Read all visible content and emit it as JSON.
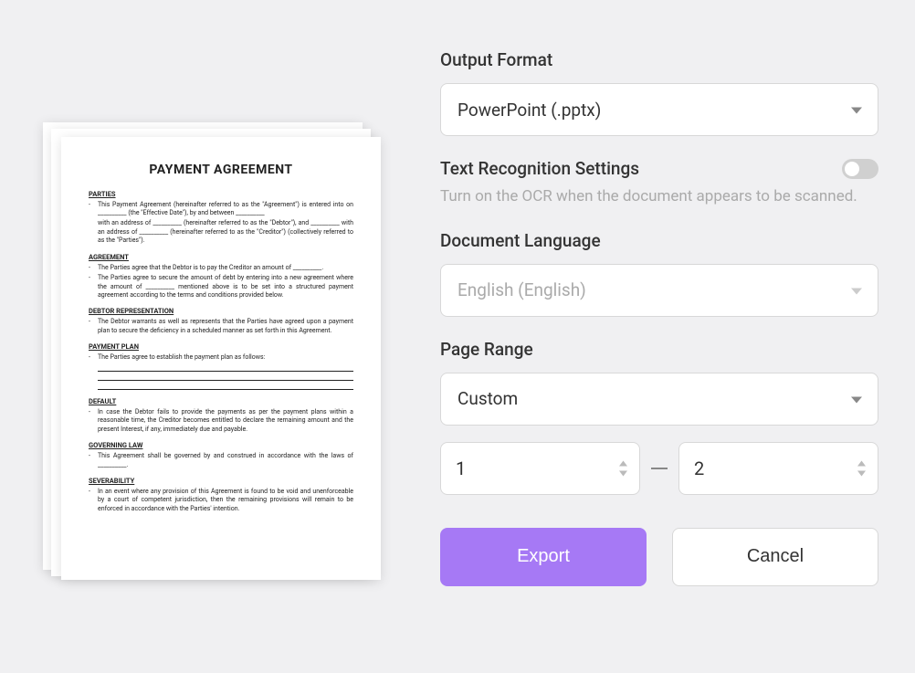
{
  "preview": {
    "doc_title": "PAYMENT AGREEMENT",
    "sections": {
      "parties": "PARTIES",
      "agreement": "AGREEMENT",
      "debtor_rep": "DEBTOR REPRESENTATION",
      "payment_plan": "PAYMENT PLAN",
      "default": "DEFAULT",
      "governing_law": "GOVERNING LAW",
      "severability": "SEVERABILITY"
    },
    "body": {
      "parties1": "This Payment Agreement (hereinafter referred to as the \"Agreement\") is entered into on __________ (the \"Effective Date\"), by and between __________",
      "parties2": "with an address of __________ (hereinafter referred to as the \"Debtor\"), and __________ with an address of __________ (hereinafter referred to as the \"Creditor\") (collectively referred to as the \"Parties\").",
      "agreement1": "The Parties agree that the Debtor is to pay the Creditor an amount of __________.",
      "agreement2": "The Parties agree to secure the amount of debt by entering into a new agreement where the amount of __________ mentioned above is to be set into a structured payment agreement according to the terms and conditions provided below.",
      "debtor1": "The Debtor warrants as well as represents that the Parties have agreed upon a payment plan to secure the deficiency in a scheduled manner as set forth in this Agreement.",
      "plan1": "The Parties agree to establish the payment plan as follows:",
      "default1": "In case the Debtor fails to provide the payments as per the payment plans within a reasonable time, the Creditor becomes entitled to declare the remaining amount and the present Interest, if any, immediately due and payable.",
      "gov1": "This Agreement shall be governed by and construed in accordance with the laws of __________.",
      "sev1": "In an event where any provision of this Agreement is found to be void and unenforceable by a court of competent jurisdiction, then the remaining provisions will remain to be enforced in accordance with the Parties' intention."
    }
  },
  "settings": {
    "output_format": {
      "label": "Output Format",
      "value": "PowerPoint (.pptx)"
    },
    "ocr": {
      "label": "Text Recognition Settings",
      "help": "Turn on the OCR when the document appears to be scanned."
    },
    "language": {
      "label": "Document Language",
      "value": "English (English)"
    },
    "page_range": {
      "label": "Page Range",
      "value": "Custom",
      "from": "1",
      "to": "2"
    },
    "buttons": {
      "export": "Export",
      "cancel": "Cancel"
    }
  }
}
